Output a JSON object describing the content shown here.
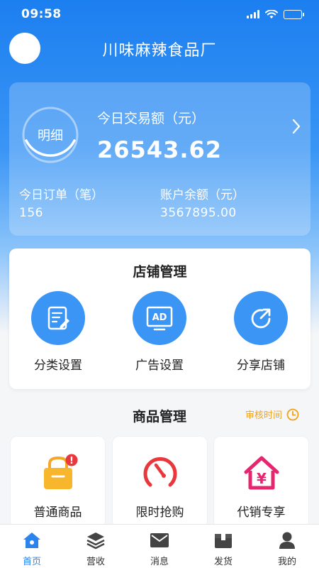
{
  "status_bar": {
    "time": "09:58"
  },
  "header": {
    "shop_name": "川味麻辣食品厂"
  },
  "stats": {
    "detail_label": "明细",
    "today_title": "今日交易额（元）",
    "today_value": "26543.62",
    "orders_label": "今日订单（笔）",
    "orders_value": "156",
    "balance_label": "账户余额（元）",
    "balance_value": "3567895.00"
  },
  "store_management": {
    "title": "店铺管理",
    "items": [
      {
        "label": "分类设置",
        "icon": "list-edit-icon"
      },
      {
        "label": "广告设置",
        "icon": "ad-icon"
      },
      {
        "label": "分享店铺",
        "icon": "share-icon"
      }
    ]
  },
  "product_management": {
    "title": "商品管理",
    "review_link": "审核时间",
    "items": [
      {
        "label": "普通商品",
        "icon": "basket-icon",
        "badge": "!"
      },
      {
        "label": "限时抢购",
        "icon": "timer-icon"
      },
      {
        "label": "代销专享",
        "icon": "house-yen-icon",
        "badge_text": "¥"
      }
    ]
  },
  "colors": {
    "primary": "#2b84ee",
    "accent_orange": "#f0a21b",
    "alert_red": "#e8383d",
    "pink": "#e6266f"
  },
  "tab_bar": {
    "items": [
      {
        "label": "首页",
        "icon": "home-icon",
        "active": true
      },
      {
        "label": "营收",
        "icon": "layers-icon",
        "active": false
      },
      {
        "label": "消息",
        "icon": "mail-icon",
        "active": false
      },
      {
        "label": "发货",
        "icon": "box-icon",
        "active": false
      },
      {
        "label": "我的",
        "icon": "person-icon",
        "active": false
      }
    ]
  }
}
